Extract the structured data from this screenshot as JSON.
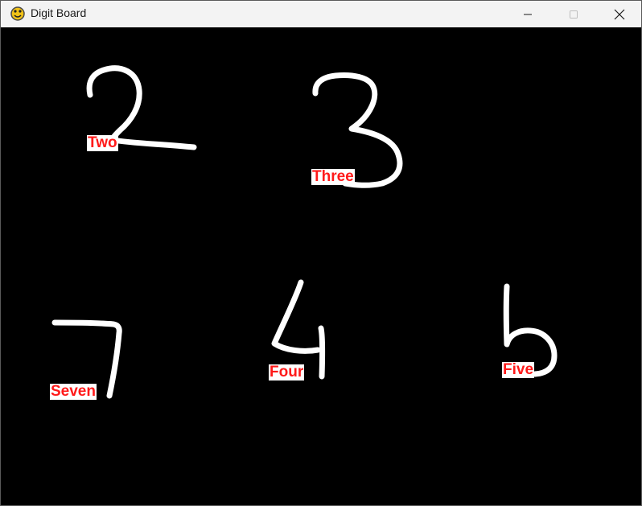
{
  "window": {
    "title": "Digit Board",
    "icon": "python-snake-icon"
  },
  "board": {
    "background": "#000000",
    "stroke_color": "#ffffff",
    "label_color": "#ff1a1a",
    "label_background": "#ffffff",
    "digits": [
      {
        "digit": "2",
        "label": "Two"
      },
      {
        "digit": "3",
        "label": "Three"
      },
      {
        "digit": "7",
        "label": "Seven"
      },
      {
        "digit": "4",
        "label": "Four"
      },
      {
        "digit": "5",
        "label": "Five"
      }
    ]
  }
}
